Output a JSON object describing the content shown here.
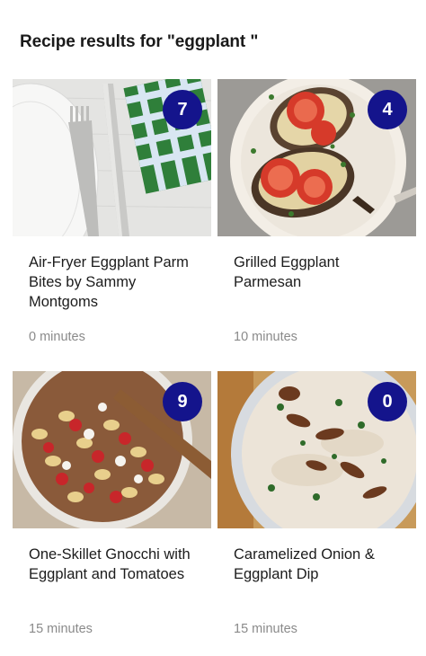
{
  "header": {
    "title": "Recipe results for \"eggplant \""
  },
  "recipes": [
    {
      "title": "Air-Fryer Eggplant Parm Bites by Sammy Montgoms",
      "count": "7",
      "time": "0 minutes",
      "image": "table-setting-plate-fork-knife"
    },
    {
      "title": "Grilled Eggplant Parmesan",
      "count": "4",
      "time": "10 minutes",
      "image": "grilled-eggplant-parmesan-plate"
    },
    {
      "title": "One-Skillet Gnocchi with Eggplant and Tomatoes",
      "count": "9",
      "time": "15 minutes",
      "image": "gnocchi-skillet"
    },
    {
      "title": "Caramelized Onion & Eggplant Dip",
      "count": "0",
      "time": "15 minutes",
      "image": "onion-eggplant-dip-bowl"
    }
  ],
  "colors": {
    "badge": "#14148c",
    "time_text": "#8a8a8a"
  }
}
